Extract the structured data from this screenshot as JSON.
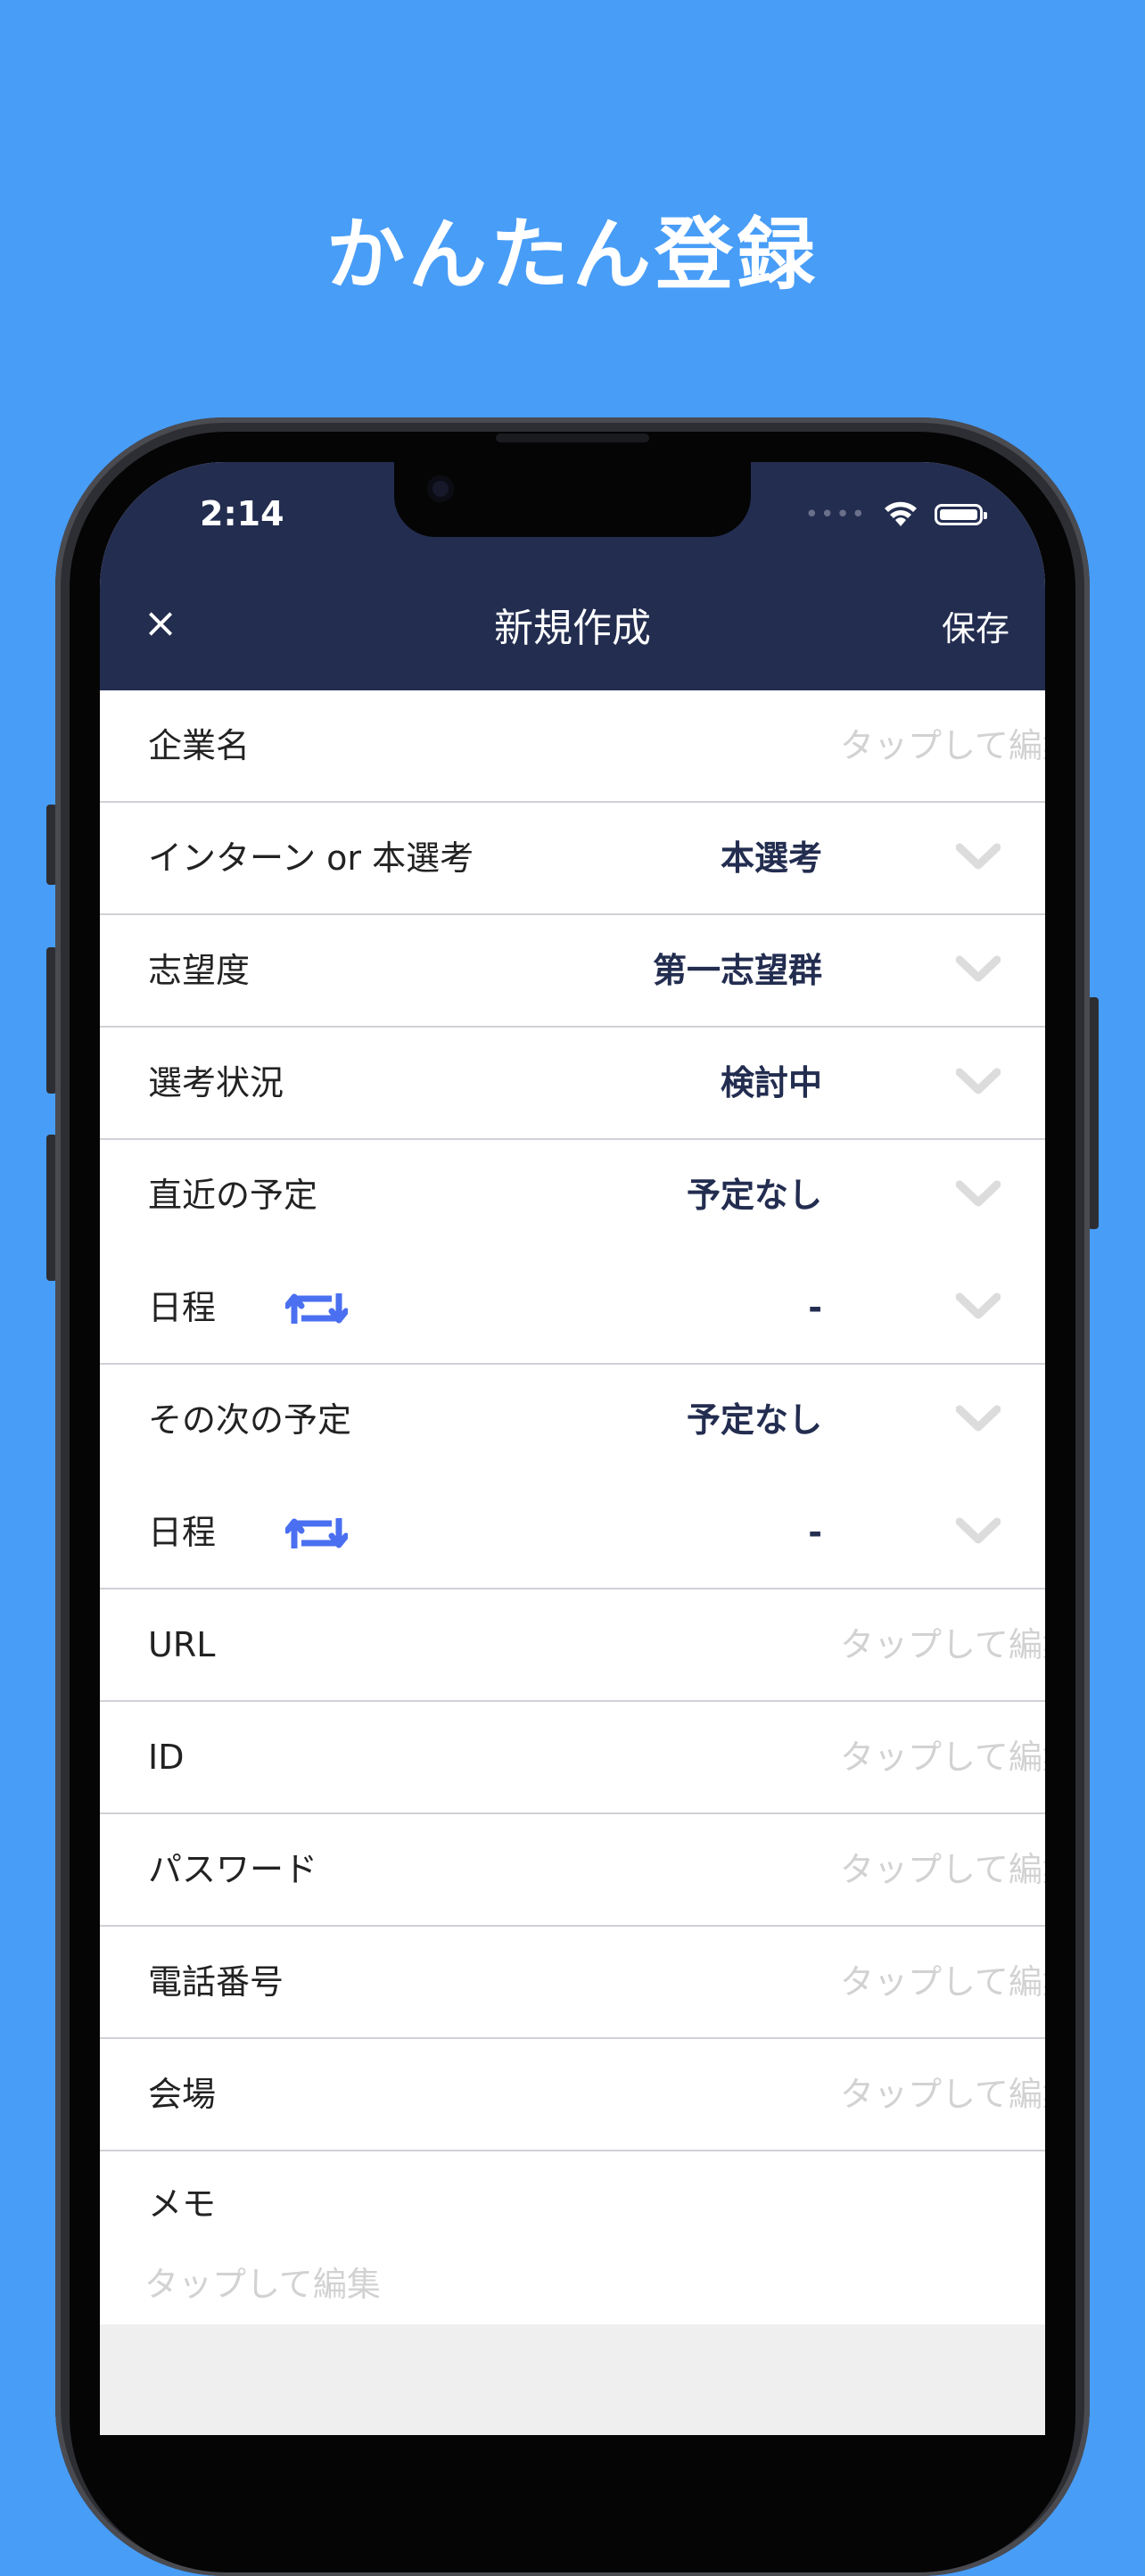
{
  "headline": "かんたん登録",
  "status_bar": {
    "time": "2:14",
    "signal": "••••"
  },
  "navbar": {
    "close_icon": "×",
    "title": "新規作成",
    "save_label": "保存"
  },
  "form": {
    "company": {
      "label": "企業名",
      "placeholder": "タップして編集"
    },
    "type": {
      "label": "インターン or 本選考",
      "value": "本選考"
    },
    "preference": {
      "label": "志望度",
      "value": "第一志望群"
    },
    "status": {
      "label": "選考状況",
      "value": "検討中"
    },
    "next_event": {
      "label": "直近の予定",
      "value": "予定なし"
    },
    "next_date": {
      "label": "日程",
      "value": "-"
    },
    "following_event": {
      "label": "その次の予定",
      "value": "予定なし"
    },
    "following_date": {
      "label": "日程",
      "value": "-"
    },
    "url": {
      "label": "URL",
      "placeholder": "タップして編集"
    },
    "id": {
      "label": "ID",
      "placeholder": "タップして編集"
    },
    "password": {
      "label": "パスワード",
      "placeholder": "タップして編集"
    },
    "phone": {
      "label": "電話番号",
      "placeholder": "タップして編集"
    },
    "venue": {
      "label": "会場",
      "placeholder": "タップして編集"
    },
    "memo": {
      "label": "メモ",
      "placeholder": "タップして編集"
    }
  },
  "colors": {
    "background": "#489df7",
    "navbar": "#232d50",
    "accent_icon": "#4a6ff0",
    "value_text": "#232d50"
  }
}
